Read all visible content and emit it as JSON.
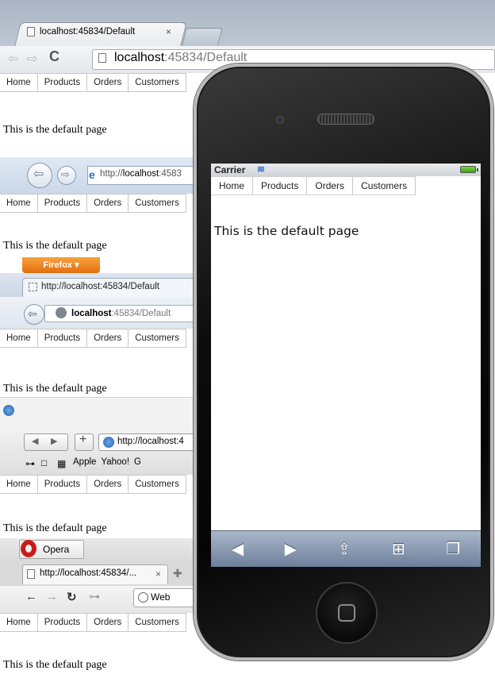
{
  "nav_items": [
    "Home",
    "Products",
    "Orders",
    "Customers"
  ],
  "page_text": "This is the default page",
  "chrome": {
    "tab_title": "localhost:45834/Default",
    "tab_close": "×",
    "url_host": "localhost",
    "url_rest": ":45834/Default"
  },
  "ie": {
    "url_prefix": "http://",
    "url_host": "localhost",
    "url_rest": ":4583"
  },
  "firefox": {
    "button_label": "Firefox ▾",
    "tab_title": "http://localhost:45834/Default",
    "url_host": "localhost",
    "url_rest": ":45834/Default"
  },
  "safari": {
    "url": "http://localhost:4",
    "bookmarks": [
      "Apple",
      "Yahoo!",
      "G"
    ]
  },
  "opera": {
    "button_label": "Opera",
    "tab_title": "http://localhost:45834/...",
    "tab_close": "×",
    "search_label": "Web"
  },
  "iphone": {
    "carrier": "Carrier",
    "page_text": "This is the default page"
  }
}
